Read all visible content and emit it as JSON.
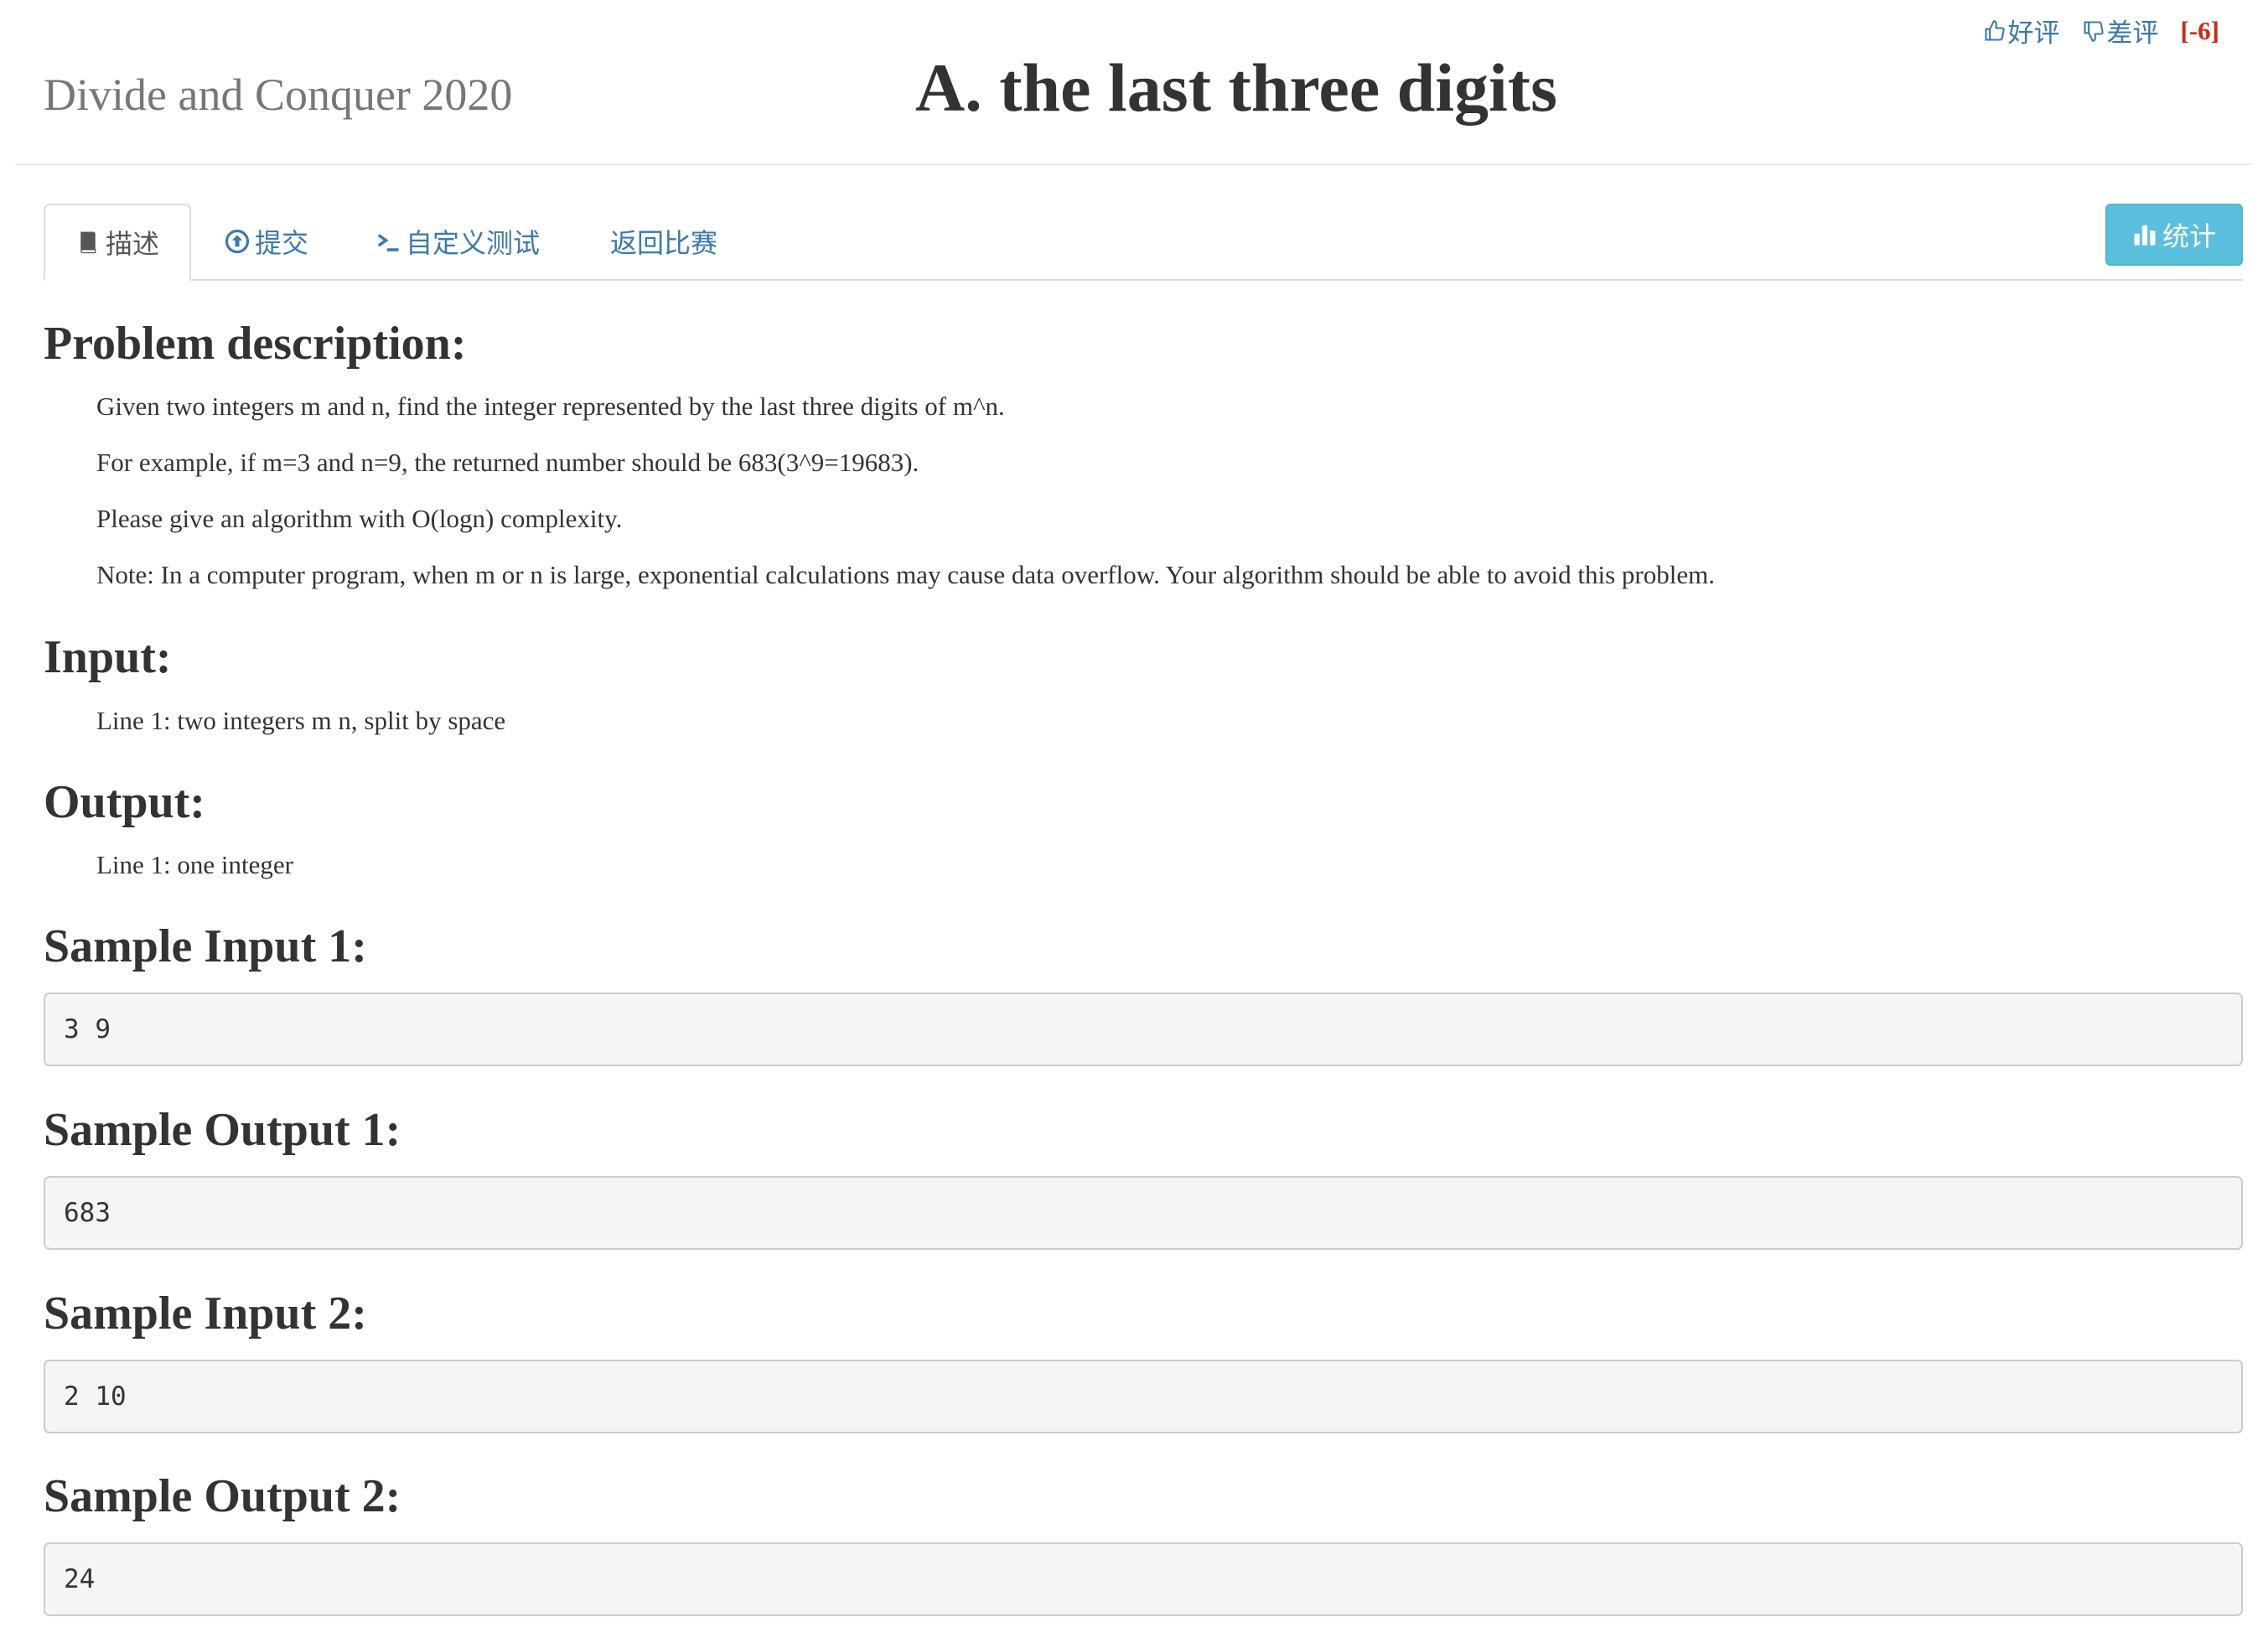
{
  "header": {
    "contest_name": "Divide and Conquer 2020",
    "problem_title": "A. the last three digits",
    "rating": {
      "like_label": "好评",
      "dislike_label": "差评",
      "score": "[-6]"
    }
  },
  "tabs": [
    {
      "label": "描述",
      "icon": "book-icon",
      "active": true
    },
    {
      "label": "提交",
      "icon": "upload-circle-icon",
      "active": false
    },
    {
      "label": "自定义测试",
      "icon": "terminal-icon",
      "active": false
    },
    {
      "label": "返回比赛",
      "icon": "",
      "active": false
    }
  ],
  "stats_button": {
    "label": "统计",
    "icon": "bar-chart-icon"
  },
  "sections": {
    "problem_description": {
      "heading": "Problem description:",
      "paragraphs": [
        "Given two integers m and n, find the integer represented by the last three digits of m^n.",
        "For example, if m=3 and n=9, the returned number should be 683(3^9=19683).",
        "Please give an algorithm with O(logn) complexity.",
        "Note: In a computer program, when m or n is large, exponential calculations may cause data overflow. Your algorithm should be able to avoid this problem."
      ]
    },
    "input": {
      "heading": "Input:",
      "text": "Line 1: two integers m n, split by space"
    },
    "output": {
      "heading": "Output:",
      "text": "Line 1: one integer"
    },
    "samples": [
      {
        "heading": "Sample Input 1:",
        "value": "3 9"
      },
      {
        "heading": "Sample Output 1:",
        "value": "683"
      },
      {
        "heading": "Sample Input 2:",
        "value": "2 10"
      },
      {
        "heading": "Sample Output 2:",
        "value": "24"
      }
    ]
  },
  "colors": {
    "link": "#337ab7",
    "score": "#d9230f",
    "info_button": "#5bc0de",
    "sample_bg": "#f5f5f5"
  }
}
